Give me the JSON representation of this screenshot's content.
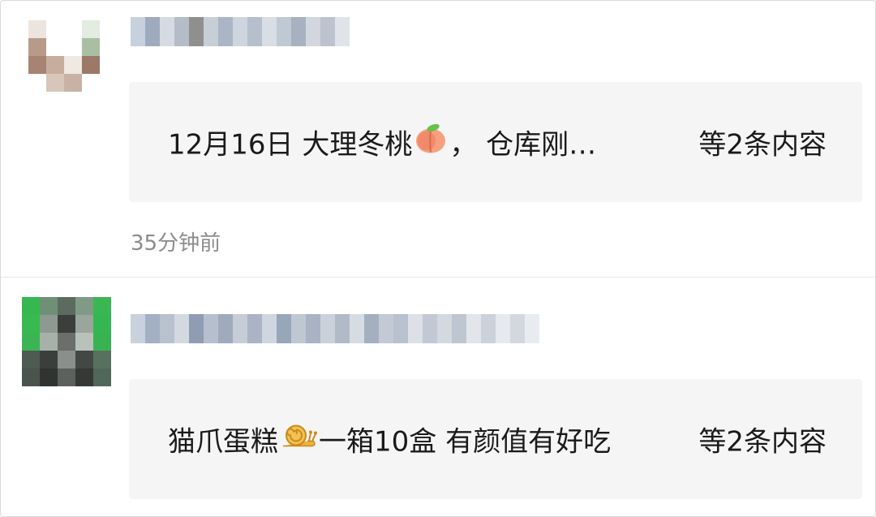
{
  "feed": {
    "items": [
      {
        "card_text": "12月16日 大理冬桃",
        "card_text_after_emoji": "，  仓库刚…",
        "emoji_icon": "peach-icon",
        "more_text": "等2条内容",
        "timestamp": "35分钟前"
      },
      {
        "card_text": "猫爪蛋糕",
        "card_text_after_emoji": "一箱10盒 有颜值有好吃",
        "emoji_icon": "snail-icon",
        "more_text": "等2条内容"
      }
    ]
  }
}
